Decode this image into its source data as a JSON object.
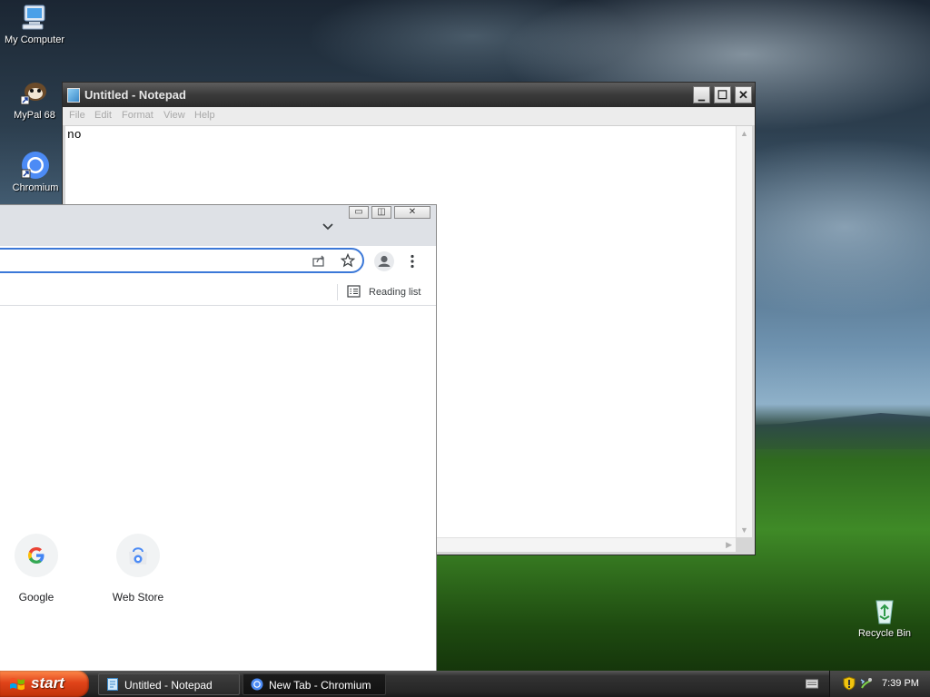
{
  "desktop": {
    "icons": [
      {
        "label": "My Computer",
        "icon": "my-computer-icon"
      },
      {
        "label": "MyPal 68",
        "icon": "mypal-icon"
      },
      {
        "label": "Chromium",
        "icon": "chromium-icon"
      },
      {
        "label": "Recycle Bin",
        "icon": "recycle-bin-icon"
      }
    ]
  },
  "notepad": {
    "title": "Untitled - Notepad",
    "menu": [
      "File",
      "Edit",
      "Format",
      "View",
      "Help"
    ],
    "content": "no",
    "controls": {
      "minimize": "▁",
      "maximize": "☐",
      "close": "✕"
    }
  },
  "chromium": {
    "reading_list_label": "Reading list",
    "shortcuts": [
      {
        "label": "Google",
        "icon": "google-icon"
      },
      {
        "label": "Web Store",
        "icon": "web-store-icon"
      }
    ]
  },
  "taskbar": {
    "start_label": "start",
    "tasks": [
      {
        "label": "Untitled - Notepad",
        "icon": "notepad-icon",
        "active": false
      },
      {
        "label": "New Tab - Chromium",
        "icon": "chromium-icon",
        "active": true
      }
    ],
    "clock": "7:39 PM"
  },
  "colors": {
    "start_button": "#e0441a",
    "omnibox_focus": "#3b78d8",
    "taskbar": "#262626"
  }
}
